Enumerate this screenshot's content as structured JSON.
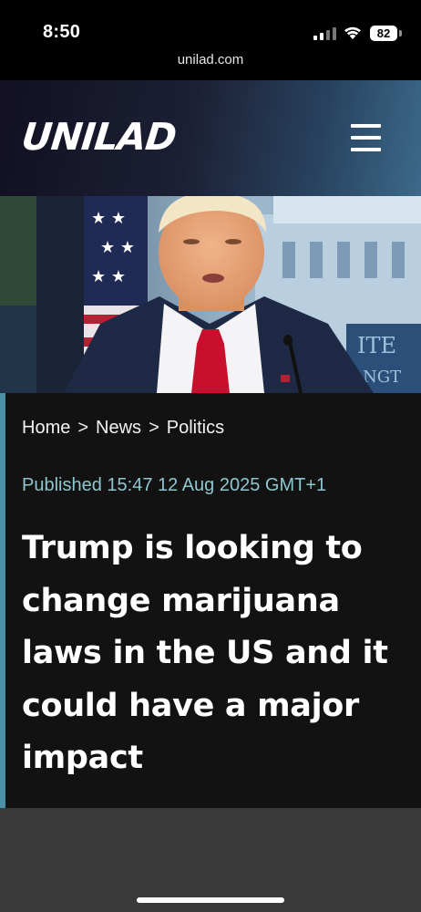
{
  "status_bar": {
    "time": "8:50",
    "url": "unilad.com",
    "battery": "82",
    "icons": [
      "signal-icon",
      "wifi-icon",
      "battery-icon"
    ]
  },
  "header": {
    "logo": "UNILAD",
    "menu_icon": "hamburger-menu-icon"
  },
  "breadcrumb": {
    "items": [
      "Home",
      "News",
      "Politics"
    ],
    "separator": ">"
  },
  "article": {
    "published": "Published 15:47 12 Aug 2025 GMT+1",
    "headline": "Trump is looking to change marijuana laws in the US and it could have a major impact",
    "hero_image": "Donald Trump speaking at a press briefing"
  },
  "colors": {
    "accent": "#4d8fa5",
    "published_text": "#8fc6cd",
    "article_bg": "#121212"
  }
}
